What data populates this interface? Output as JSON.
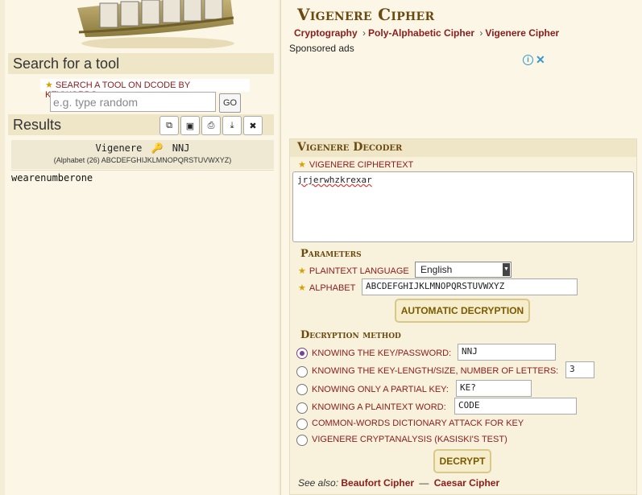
{
  "search": {
    "title": "Search for a tool",
    "label": "Search a tool on dCode by keywords:",
    "placeholder": "e.g. type random",
    "go_label": "GO"
  },
  "results": {
    "title": "Results",
    "toolbar_icons": [
      "copy-icon",
      "screenshot-icon",
      "print-icon",
      "download-icon",
      "close-icon"
    ],
    "cipher_name": "Vigenere",
    "key_icon": "key-icon",
    "key": "NNJ",
    "alphabet_line": "(Alphabet (26) ABCDEFGHIJKLMNOPQRSTUVWXYZ)",
    "plaintext": "wearenumberone"
  },
  "header": {
    "title": "Vigenere Cipher",
    "breadcrumb": [
      "Cryptography",
      "Poly-Alphabetic Cipher",
      "Vigenere Cipher"
    ],
    "breadcrumb_separator": "›",
    "sponsored": "Sponsored ads"
  },
  "decoder": {
    "title": "Vigenere Decoder",
    "ciphertext_label": "Vigenere ciphertext",
    "ciphertext": "jrjerwhzkrexar",
    "parameters_title": "Parameters",
    "language_label": "Plaintext language",
    "language": "English",
    "alphabet_label": "Alphabet",
    "alphabet": "ABCDEFGHIJKLMNOPQRSTUVWXYZ",
    "auto_button": "AUTOMATIC DECRYPTION",
    "method_title": "Decryption method",
    "methods": [
      {
        "label": "Knowing the key/password:",
        "value": "NNJ",
        "selected": true
      },
      {
        "label": "Knowing the key-length/size, number of letters:",
        "value": "3",
        "selected": false
      },
      {
        "label": "Knowing only a partial key:",
        "value": "KE?",
        "selected": false
      },
      {
        "label": "Knowing a plaintext word:",
        "value": "CODE",
        "selected": false
      },
      {
        "label": "Common-words dictionary attack for key",
        "selected": false
      },
      {
        "label": "Vigenere cryptanalysis (Kasiski's test)",
        "selected": false
      }
    ],
    "decrypt_button": "DECRYPT",
    "see_also_label": "See also:",
    "see_also_links": [
      "Beaufort Cipher",
      "Caesar Cipher"
    ],
    "see_also_separator": "—"
  },
  "colors": {
    "background": "#f4ecd4",
    "panel": "#fbf6e6",
    "title_brown": "#6b4a10",
    "link_red": "#8a1c1c",
    "star_gold": "#d8a000",
    "radio_purple": "#7a3f8f"
  }
}
